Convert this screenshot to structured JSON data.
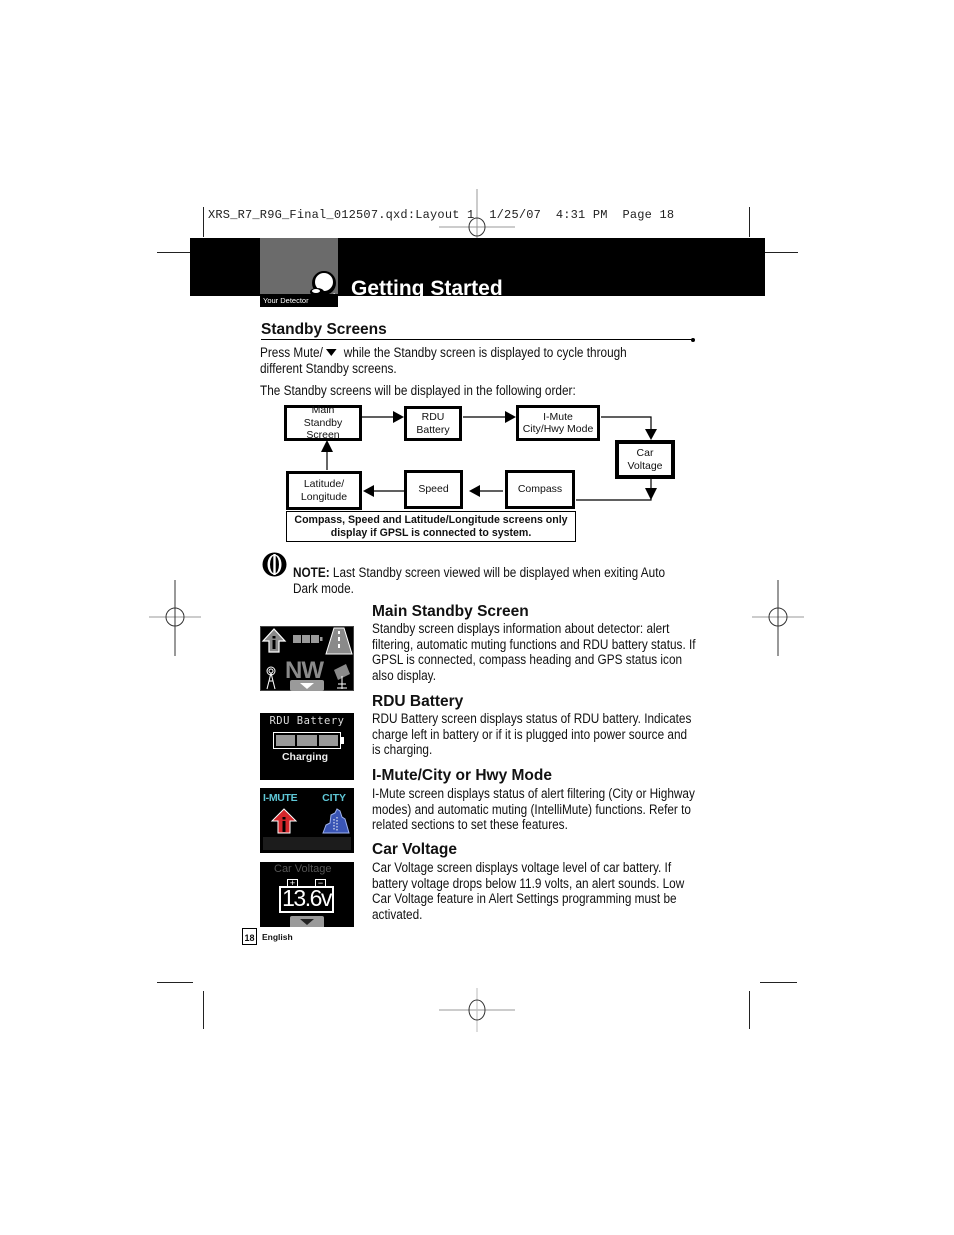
{
  "slug_line": "XRS_R7_R9G_Final_012507.qxd:Layout 1  1/25/07  4:31 PM  Page 18",
  "header": {
    "section_tab": "Your Detector",
    "title": "Getting Started"
  },
  "standby": {
    "title": "Standby Screens",
    "intro_before_icon": "Press Mute/",
    "intro_icon": "down-triangle-icon",
    "intro_after_icon": " while the Standby screen is displayed to cycle through different Standby screens.",
    "order_text": "The Standby screens will be displayed in the following order:"
  },
  "flowchart": {
    "nodes": {
      "main": "Main Standby Screen",
      "rdu": "RDU Battery",
      "imute": "I-Mute City/Hwy Mode",
      "car": "Car Voltage",
      "compass": "Compass",
      "speed": "Speed",
      "latlon": "Latitude/ Longitude"
    },
    "order": [
      "Main Standby Screen",
      "RDU Battery",
      "I-Mute City/Hwy Mode",
      "Car Voltage",
      "Compass",
      "Speed",
      "Latitude/ Longitude"
    ],
    "footnote": "Compass, Speed and Latitude/Longitude screens only display if GPSL is connected to system."
  },
  "note": {
    "label": "NOTE:",
    "text": " Last Standby screen viewed will be displayed when exiting Auto Dark mode."
  },
  "screens": [
    {
      "title": "Main Standby Screen",
      "description": "Standby screen displays information about detector: alert filtering, automatic muting functions and RDU battery status. If GPSL is connected, compass heading and GPS status icon also display.",
      "display": {
        "heading": "NW"
      }
    },
    {
      "title": "RDU Battery",
      "description": "RDU Battery screen displays status of RDU battery. Indicates charge left in battery or if it is plugged into power source and is charging.",
      "display": {
        "label": "RDU Battery",
        "status": "Charging",
        "charge_segments": 3
      }
    },
    {
      "title": "I-Mute/City or Hwy Mode",
      "description": "I-Mute screen displays status of alert filtering (City or Highway modes) and automatic muting (IntelliMute) functions. Refer to related sections to set these features.",
      "display": {
        "left_label": "I-MUTE",
        "right_label": "CITY"
      }
    },
    {
      "title": "Car Voltage",
      "description": "Car Voltage screen displays voltage level of car battery. If battery voltage drops below 11.9 volts, an alert sounds. Low Car Voltage feature in Alert Settings programming must be activated.",
      "display": {
        "label": "Car Voltage",
        "value": "13.6v",
        "plus": "+",
        "minus": "−"
      }
    }
  ],
  "footer": {
    "page_number": "18",
    "language": "English"
  },
  "colors": {
    "imute_label": "#5fc7d6",
    "imute_arrow": "#d6262b",
    "city_icon": "#3a55b5",
    "screen_gray": "#8a8a8a"
  }
}
